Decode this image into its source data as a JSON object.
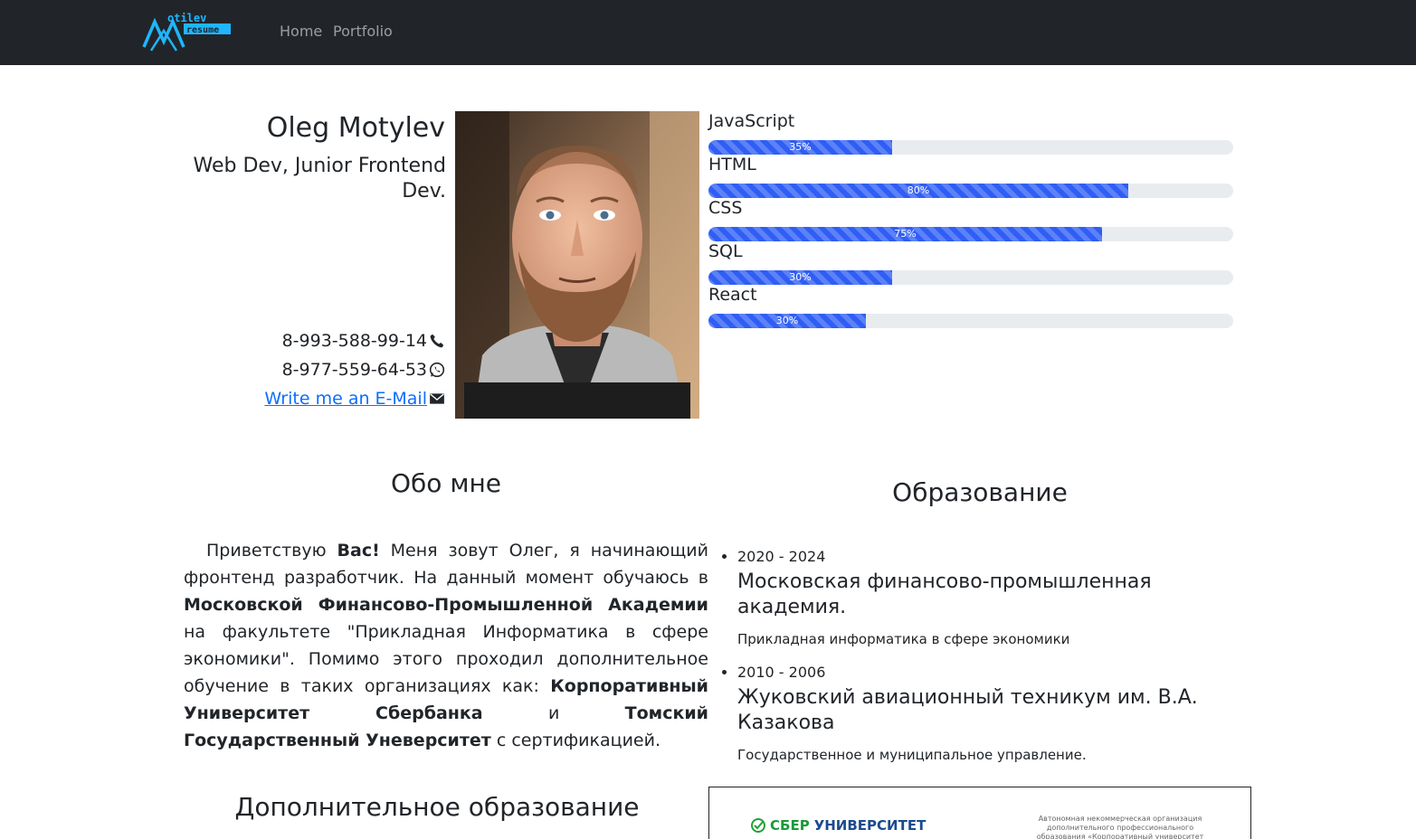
{
  "nav": {
    "logo_top": "otilev",
    "logo_bottom": "resume",
    "items": [
      {
        "label": "Home"
      },
      {
        "label": "Portfolio"
      }
    ]
  },
  "profile": {
    "name": "Oleg Motylev",
    "role": "Web Dev, Junior Frontend Dev.",
    "phone": "8-993-588-99-14",
    "whatsapp": "8-977-559-64-53",
    "email_link": "Write me an E-Mail",
    "icons": [
      "phone-icon",
      "whatsapp-icon",
      "mail-icon"
    ]
  },
  "skills": [
    {
      "name": "JavaScript",
      "label": "35%",
      "fill": 0.35
    },
    {
      "name": "HTML",
      "label": "80%",
      "fill": 0.8
    },
    {
      "name": "CSS",
      "label": "75%",
      "fill": 0.75
    },
    {
      "name": "SQL",
      "label": "30%",
      "fill": 0.35
    },
    {
      "name": "React",
      "label": "30%",
      "fill": 0.3
    }
  ],
  "about": {
    "heading": "Обо мне",
    "t1": "Приветствую ",
    "b1": "Вас!",
    "t2": " Меня зовут Олег, я начинающий фронтенд разработчик. На данный момент обучаюсь в ",
    "b2": "Московской Финансово-Промышленной Академии",
    "t3": " на факультете \"Прикладная Информатика в сфере экономики\". Помимо этого проходил дополнительное обучение в таких организациях как: ",
    "b3": "Корпоративный Университет Сбербанка",
    "t4": " и ",
    "b4": "Томский Государственный Уневерситет",
    "t5": " с сертификацией."
  },
  "education": {
    "heading": "Образование",
    "items": [
      {
        "years": "2020 - 2024",
        "school": "Московская финансово-промышленная академия.",
        "spec": "Прикладная информатика в сфере экономики"
      },
      {
        "years": "2010 - 2006",
        "school": "Жуковский авиационный техникум им. В.А. Казакова",
        "spec": "Государственное и муниципальное управление."
      }
    ]
  },
  "extra": {
    "heading": "Дополнительное образование"
  },
  "certificate": {
    "logo_a": "СБЕР",
    "logo_b": "УНИВЕРСИТЕТ",
    "org": "Автономная некоммерческая организация дополнительного профессионального образования «Корпоративный университет Сбербанка»"
  },
  "colors": {
    "navbar": "#212529",
    "accent": "#2f5ef5",
    "link": "#0d6efd"
  }
}
